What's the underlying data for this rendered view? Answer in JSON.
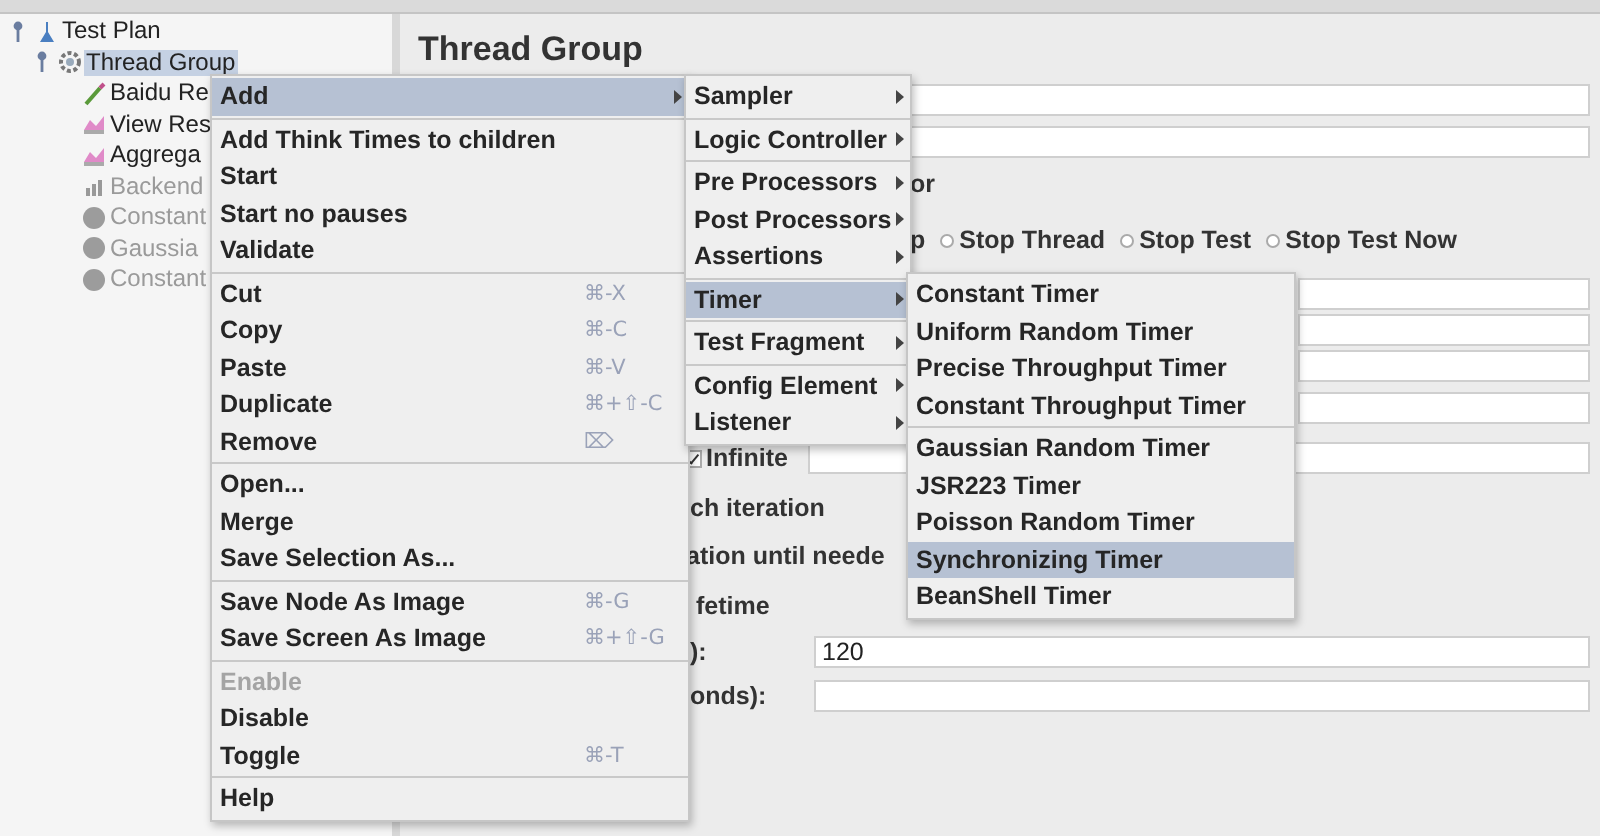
{
  "tree": [
    {
      "label": "Test Plan",
      "kind": "plan",
      "expanded": true,
      "selected": false,
      "disabled": false,
      "children": [
        {
          "label": "Thread Group",
          "kind": "thread",
          "expanded": true,
          "selected": true,
          "disabled": false,
          "children": [
            {
              "label": "Baidu Re",
              "kind": "sampler",
              "selected": false,
              "disabled": false
            },
            {
              "label": "View Res",
              "kind": "listener",
              "selected": false,
              "disabled": false
            },
            {
              "label": "Aggrega",
              "kind": "listener",
              "selected": false,
              "disabled": false
            },
            {
              "label": "Backend",
              "kind": "backend",
              "selected": false,
              "disabled": true
            },
            {
              "label": "Constant",
              "kind": "timer",
              "selected": false,
              "disabled": true
            },
            {
              "label": "Gaussia",
              "kind": "timer",
              "selected": false,
              "disabled": true
            },
            {
              "label": "Constant",
              "kind": "timer",
              "selected": false,
              "disabled": true
            }
          ]
        }
      ]
    }
  ],
  "panel": {
    "title": "Thread Group",
    "rows": [
      {
        "kind": "field"
      },
      {
        "kind": "field"
      },
      {
        "kind": "text",
        "text": "or"
      },
      {
        "kind": "radios",
        "text": "p",
        "options": [
          {
            "label": "Stop Thread",
            "selected": false
          },
          {
            "label": "Stop Test",
            "selected": false
          },
          {
            "label": "Stop Test Now",
            "selected": false
          }
        ]
      },
      {
        "kind": "field"
      },
      {
        "kind": "field"
      },
      {
        "kind": "field"
      },
      {
        "kind": "field"
      },
      {
        "kind": "checkbox",
        "label": "Infinite",
        "checked": true
      },
      {
        "kind": "text",
        "text": "ch iteration"
      },
      {
        "kind": "text",
        "text": "ation until neede"
      },
      {
        "kind": "text",
        "text": "fetime"
      },
      {
        "kind": "labeled_field",
        "label": "):",
        "value": "120"
      },
      {
        "kind": "labeled_field",
        "label": "onds):"
      }
    ]
  },
  "context_menu": {
    "groups": [
      [
        {
          "label": "Add",
          "submenu": true,
          "selected": true,
          "disabled": false
        }
      ],
      [
        {
          "label": "Add Think Times to children",
          "submenu": false,
          "selected": false,
          "disabled": false
        },
        {
          "label": "Start",
          "submenu": false,
          "selected": false,
          "disabled": false
        },
        {
          "label": "Start no pauses",
          "submenu": false,
          "selected": false,
          "disabled": false
        },
        {
          "label": "Validate",
          "submenu": false,
          "selected": false,
          "disabled": false
        }
      ],
      [
        {
          "label": "Cut",
          "shortcut": "⌘-X",
          "submenu": false,
          "selected": false,
          "disabled": false
        },
        {
          "label": "Copy",
          "shortcut": "⌘-C",
          "submenu": false,
          "selected": false,
          "disabled": false
        },
        {
          "label": "Paste",
          "shortcut": "⌘-V",
          "submenu": false,
          "selected": false,
          "disabled": false
        },
        {
          "label": "Duplicate",
          "shortcut": "⌘+⇧-C",
          "submenu": false,
          "selected": false,
          "disabled": false
        },
        {
          "label": "Remove",
          "shortcut": "⌦",
          "submenu": false,
          "selected": false,
          "disabled": false
        }
      ],
      [
        {
          "label": "Open...",
          "submenu": false,
          "selected": false,
          "disabled": false
        },
        {
          "label": "Merge",
          "submenu": false,
          "selected": false,
          "disabled": false
        },
        {
          "label": "Save Selection As...",
          "submenu": false,
          "selected": false,
          "disabled": false
        }
      ],
      [
        {
          "label": "Save Node As Image",
          "shortcut": "⌘-G",
          "submenu": false,
          "selected": false,
          "disabled": false
        },
        {
          "label": "Save Screen As Image",
          "shortcut": "⌘+⇧-G",
          "submenu": false,
          "selected": false,
          "disabled": false
        }
      ],
      [
        {
          "label": "Enable",
          "submenu": false,
          "selected": false,
          "disabled": true
        },
        {
          "label": "Disable",
          "submenu": false,
          "selected": false,
          "disabled": false
        },
        {
          "label": "Toggle",
          "shortcut": "⌘-T",
          "submenu": false,
          "selected": false,
          "disabled": false
        }
      ],
      [
        {
          "label": "Help",
          "submenu": false,
          "selected": false,
          "disabled": false
        }
      ]
    ]
  },
  "add_submenu": {
    "groups": [
      [
        {
          "label": "Sampler",
          "submenu": true,
          "selected": false
        }
      ],
      [
        {
          "label": "Logic Controller",
          "submenu": true,
          "selected": false
        }
      ],
      [
        {
          "label": "Pre Processors",
          "submenu": true,
          "selected": false
        },
        {
          "label": "Post Processors",
          "submenu": true,
          "selected": false
        },
        {
          "label": "Assertions",
          "submenu": true,
          "selected": false
        }
      ],
      [
        {
          "label": "Timer",
          "submenu": true,
          "selected": true
        }
      ],
      [
        {
          "label": "Test Fragment",
          "submenu": true,
          "selected": false
        }
      ],
      [
        {
          "label": "Config Element",
          "submenu": true,
          "selected": false
        },
        {
          "label": "Listener",
          "submenu": true,
          "selected": false
        }
      ]
    ]
  },
  "timer_submenu": {
    "groups": [
      [
        {
          "label": "Constant Timer",
          "selected": false
        },
        {
          "label": "Uniform Random Timer",
          "selected": false
        },
        {
          "label": "Precise Throughput Timer",
          "selected": false
        },
        {
          "label": "Constant Throughput Timer",
          "selected": false
        }
      ],
      [
        {
          "label": "Gaussian Random Timer",
          "selected": false
        },
        {
          "label": "JSR223 Timer",
          "selected": false
        },
        {
          "label": "Poisson Random Timer",
          "selected": false
        },
        {
          "label": "Synchronizing Timer",
          "selected": true
        },
        {
          "label": "BeanShell Timer",
          "selected": false
        }
      ]
    ]
  }
}
